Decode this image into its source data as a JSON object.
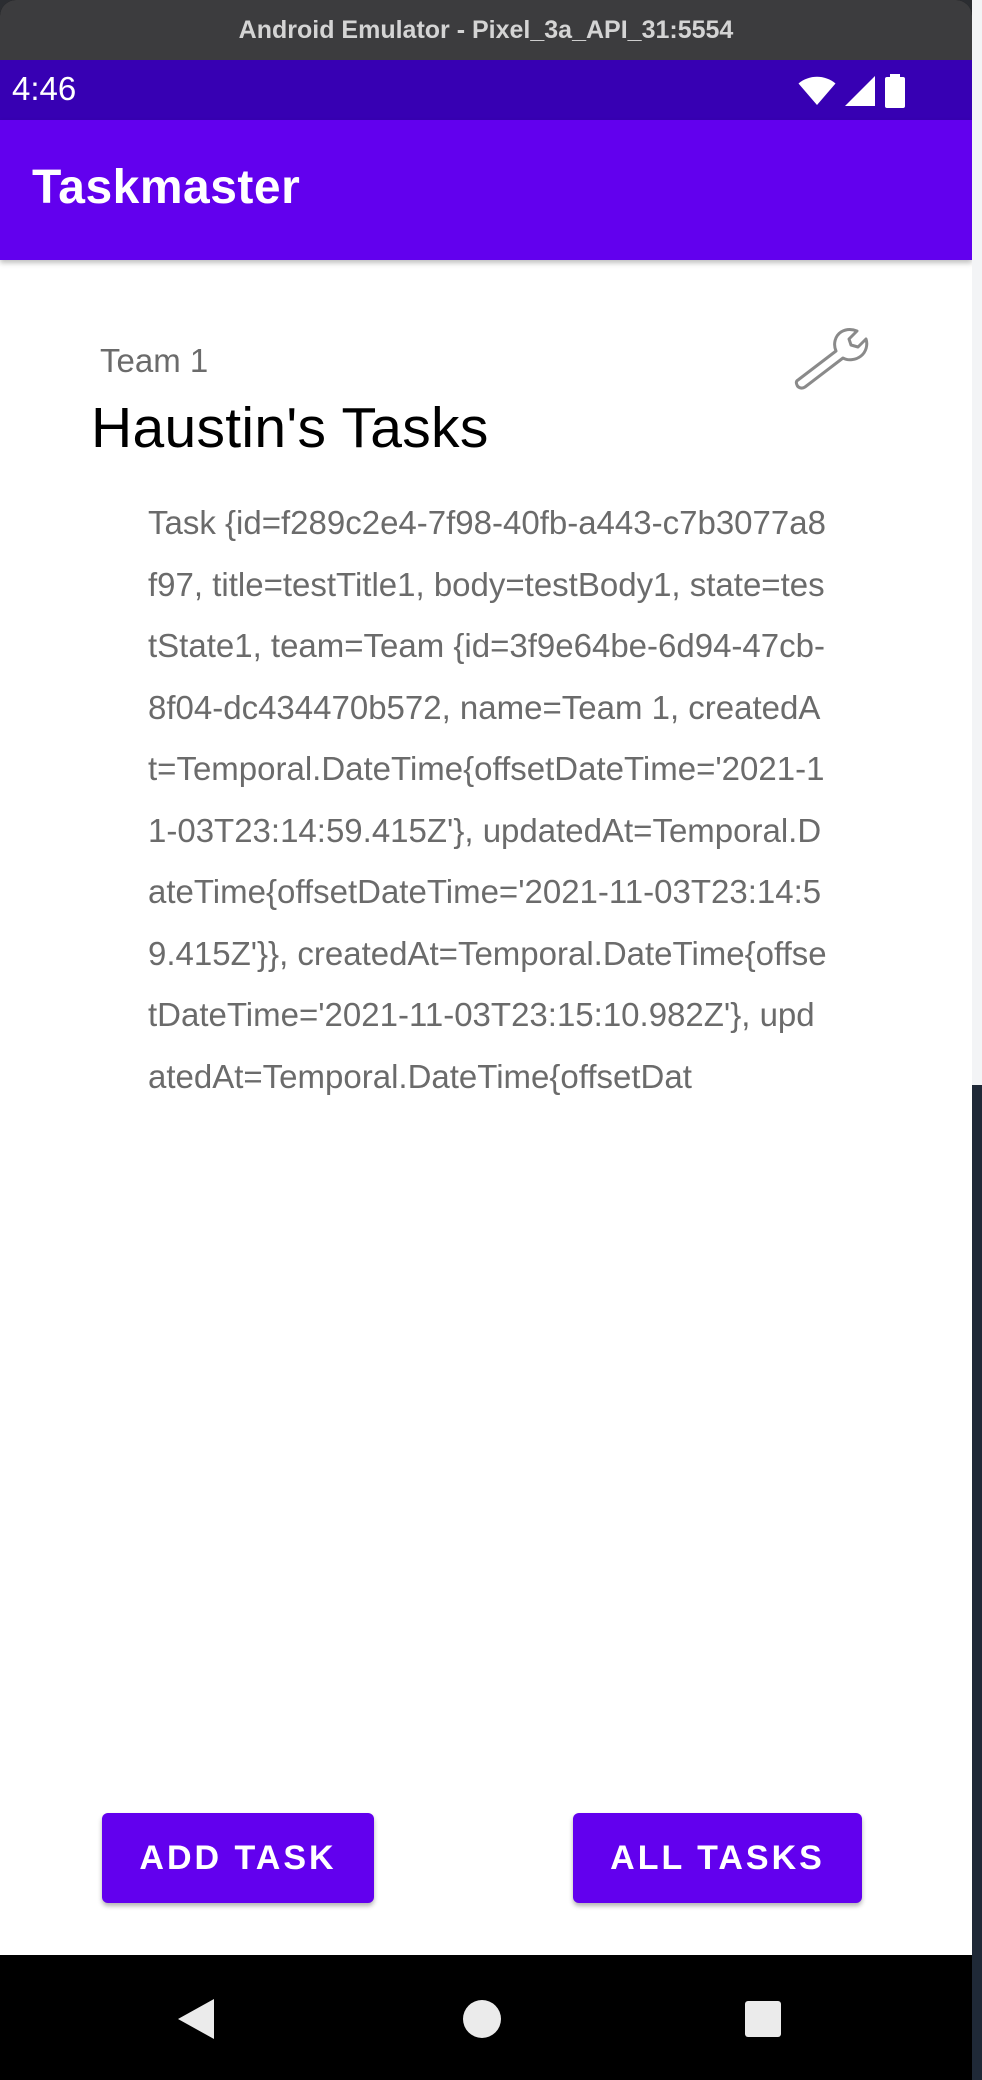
{
  "emulator": {
    "window_title": "Android Emulator - Pixel_3a_API_31:5554"
  },
  "status_bar": {
    "time": "4:46",
    "icons": [
      "wifi-icon",
      "signal-icon",
      "battery-icon"
    ]
  },
  "app_bar": {
    "title": "Taskmaster"
  },
  "main": {
    "team_label": "Team 1",
    "page_title": "Haustin's Tasks",
    "task_text": "Task {id=f289c2e4-7f98-40fb-a443-c7b3077a8f97, title=testTitle1, body=testBody1, state=testState1, team=Team {id=3f9e64be-6d94-47cb-8f04-dc434470b572, name=Team 1, createdAt=Temporal.DateTime{offsetDateTime='2021-11-03T23:14:59.415Z'}, updatedAt=Temporal.DateTime{offsetDateTime='2021-11-03T23:14:59.415Z'}}, createdAt=Temporal.DateTime{offsetDateTime='2021-11-03T23:15:10.982Z'}, updatedAt=Temporal.DateTime{offsetDat",
    "settings_icon": "wrench-icon"
  },
  "buttons": {
    "add_task": "ADD TASK",
    "all_tasks": "ALL TASKS"
  },
  "nav_bar": {
    "icons": [
      "back-icon",
      "home-icon",
      "recents-icon"
    ]
  },
  "colors": {
    "primary": "#6200ee",
    "primary_dark": "#3700b3",
    "secondary_text": "#6b6b6b"
  }
}
